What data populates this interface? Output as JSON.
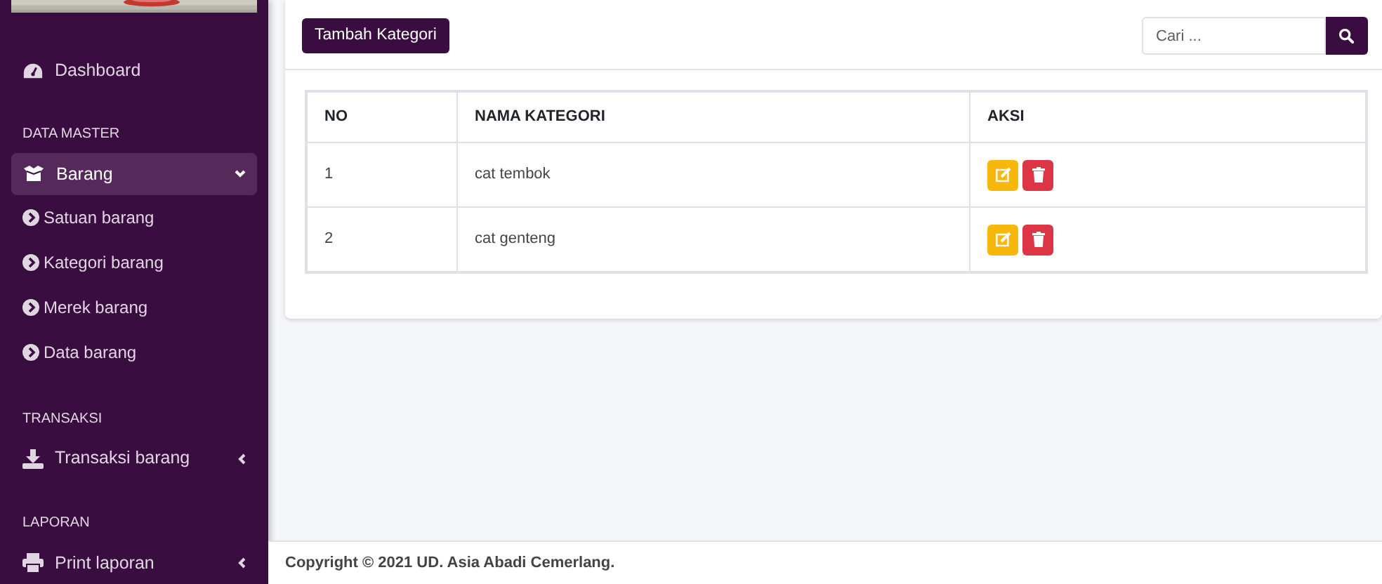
{
  "sidebar": {
    "items": [
      {
        "kind": "item",
        "label": "Dashboard",
        "selected": false
      },
      {
        "kind": "header",
        "label": "DATA MASTER"
      },
      {
        "kind": "item",
        "label": "Barang",
        "selected": true,
        "expanded": true,
        "children": [
          {
            "label": "Satuan barang",
            "selected": false
          },
          {
            "label": "Kategori barang",
            "selected": false
          },
          {
            "label": "Merek barang",
            "selected": false
          },
          {
            "label": "Data barang",
            "selected": false
          }
        ]
      },
      {
        "kind": "header",
        "label": "TRANSAKSI"
      },
      {
        "kind": "item",
        "label": "Transaksi barang",
        "selected": false,
        "expanded": false
      },
      {
        "kind": "header",
        "label": "LAPORAN"
      },
      {
        "kind": "item",
        "label": "Print laporan",
        "selected": false,
        "expanded": false
      }
    ]
  },
  "toolbar": {
    "add_button": "Tambah Kategori",
    "search": {
      "placeholder": "Cari ..."
    }
  },
  "table": {
    "columns": [
      "NO",
      "NAMA KATEGORI",
      "AKSI"
    ],
    "rows": [
      {
        "no": "1",
        "name": "cat tembok"
      },
      {
        "no": "2",
        "name": "cat genteng"
      }
    ]
  },
  "footer": "Copyright © 2021 UD. Asia Abadi Cemerlang."
}
